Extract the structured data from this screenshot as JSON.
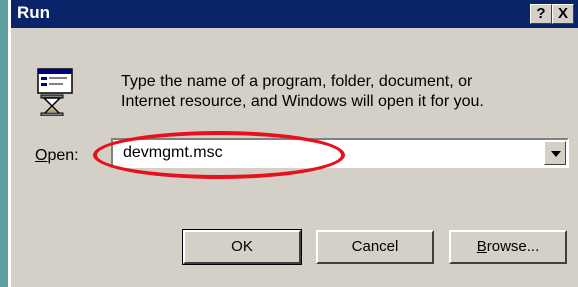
{
  "window": {
    "title": "Run",
    "help_label": "?",
    "close_label": "X"
  },
  "prompt": {
    "line1": "Type the name of a program, folder, document, or",
    "line2": "Internet resource, and Windows will open it for you."
  },
  "open": {
    "label_prefix": "O",
    "label_rest": "pen:",
    "value": "devmgmt.msc"
  },
  "buttons": {
    "ok": "OK",
    "cancel": "Cancel",
    "browse_prefix": "B",
    "browse_rest": "rowse..."
  },
  "colors": {
    "titlebar": "#0a246a",
    "highlight": "#e8101a",
    "dialog": "#d4d0c8"
  }
}
